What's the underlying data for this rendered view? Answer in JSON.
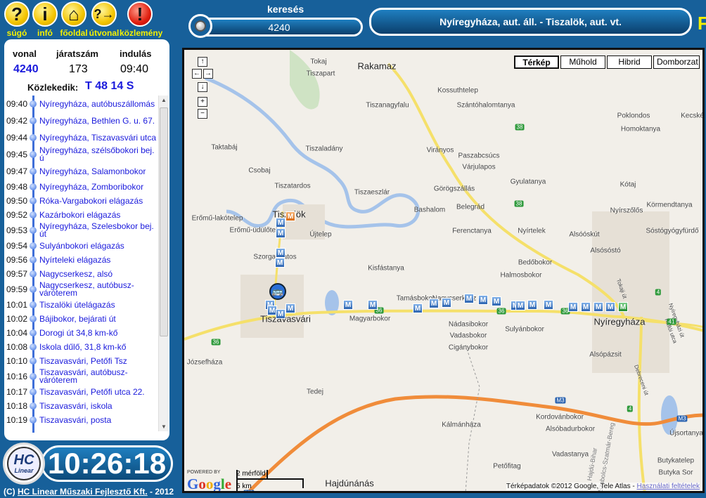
{
  "toolbar": {
    "items": [
      {
        "label": "súgó",
        "icon": "help-icon"
      },
      {
        "label": "infó",
        "icon": "info-icon"
      },
      {
        "label": "főoldal",
        "icon": "home-icon"
      },
      {
        "label": "útvonal",
        "icon": "route-icon"
      },
      {
        "label": "közlemény",
        "icon": "alert-icon"
      }
    ]
  },
  "trip": {
    "vonal_label": "vonal",
    "jaratszam_label": "járatszám",
    "indulas_label": "indulás",
    "vonal": "4240",
    "jaratszam": "173",
    "indulas": "09:40",
    "kozlekedik_label": "Közlekedik:",
    "kozlekedik": "T 48 14 S"
  },
  "stops": [
    {
      "time": "09:40",
      "name": "Nyíregyháza, autóbuszállomás"
    },
    {
      "time": "09:42",
      "name": "Nyíregyháza, Bethlen G. u. 67."
    },
    {
      "time": "09:44",
      "name": "Nyíregyháza, Tiszavasvári utca"
    },
    {
      "time": "09:45",
      "name": "Nyíregyháza, szélsőbokori bej. ú"
    },
    {
      "time": "09:47",
      "name": "Nyíregyháza, Salamonbokor"
    },
    {
      "time": "09:48",
      "name": "Nyíregyháza, Zomboribokor"
    },
    {
      "time": "09:50",
      "name": "Róka-Vargabokori elágazás"
    },
    {
      "time": "09:52",
      "name": "Kazárbokori elágazás"
    },
    {
      "time": "09:53",
      "name": "Nyíregyháza, Szelesbokor bej. út"
    },
    {
      "time": "09:54",
      "name": "Sulyánbokori elágazás"
    },
    {
      "time": "09:56",
      "name": "Nyírteleki elágazás"
    },
    {
      "time": "09:57",
      "name": "Nagycserkesz, alsó"
    },
    {
      "time": "09:59",
      "name": "Nagycserkesz, autóbusz-váróterem"
    },
    {
      "time": "10:01",
      "name": "Tiszalöki útelágazás"
    },
    {
      "time": "10:02",
      "name": "Bájibokor, bejárati út"
    },
    {
      "time": "10:04",
      "name": "Dorogi út 34,8 km-kő"
    },
    {
      "time": "10:08",
      "name": "Iskola dűlő, 31,8 km-kő"
    },
    {
      "time": "10:10",
      "name": "Tiszavasvári, Petőfi Tsz"
    },
    {
      "time": "10:16",
      "name": "Tiszavasvári, autóbusz-váróterem"
    },
    {
      "time": "10:17",
      "name": "Tiszavasvári, Petőfi utca 22."
    },
    {
      "time": "10:18",
      "name": "Tiszavasvári, iskola"
    },
    {
      "time": "10:19",
      "name": "Tiszavasvári, posta"
    }
  ],
  "clock": {
    "time": "10:26:18",
    "logo_text": "HC Linear"
  },
  "footer": {
    "prefix": "(C) ",
    "company": "HC Linear Műszaki Fejlesztő Kft.",
    "suffix": " - 2012"
  },
  "search": {
    "label": "keresés",
    "value": "4240"
  },
  "route_title": "Nyíregyháza, aut. áll. - Tiszalök, aut. vt.",
  "cut_text": "F",
  "map": {
    "types": [
      "Térkép",
      "Műhold",
      "Hibrid",
      "Domborzat"
    ],
    "active_type": "Térkép",
    "nav": {
      "up": "↑",
      "left": "←",
      "right": "→",
      "down": "↓",
      "zoom_in": "+",
      "zoom_out": "−"
    },
    "places": [
      "Tokaj",
      "Rakamaz",
      "Tiszapart",
      "Tiszanagyfalu",
      "Kossuthtelep",
      "Szántóhalomtanya",
      "Poklondos",
      "Homoktanya",
      "Kecskés",
      "Taktabáj",
      "Tiszaladány",
      "Virányos",
      "Paszabcsúcs",
      "Várjulapos",
      "Csobaj",
      "Gyulatanya",
      "Kótaj",
      "Tiszatardos",
      "Tiszaeszlár",
      "Görögszállás",
      "Bashalom",
      "Belegrád",
      "Nyírszőlős",
      "Körmendtanya",
      "Erőmű-lakótelep",
      "Erőmű-üdülőtelep",
      "Tiszalök",
      "Újtelep",
      "Ferenctanya",
      "Nyírtelek",
      "Alsóóskút",
      "Sóstógyógyfürdő",
      "Szorgalmatos",
      "Alsósóstó",
      "Kisfástanya",
      "Bedőbokor",
      "Halmosbokor",
      "Tamásbokor",
      "Nagycserkesz",
      "Magyarbokor",
      "Nádasibokor",
      "Sulyánbokor",
      "Vadasbokor",
      "Tiszavasvári",
      "Nyíregyháza",
      "Cigánybokor",
      "Józsefháza",
      "Alsópázsit",
      "Tedej",
      "Kálmánháza",
      "Kordovánbokor",
      "Alsóbadurbokor",
      "Újsortanya",
      "Vadastanya",
      "Petőfitag",
      "Butykatelep",
      "Butyka Sor",
      "Hajdúnánás",
      "Tokaji út",
      "Debreceni út",
      "Kállói utca",
      "Nyíregyházi út",
      "Hajdú-Bihar",
      "Szabolcs-Szatmár-Bereg"
    ],
    "road_numbers": [
      "38",
      "38",
      "36",
      "36",
      "36",
      "36",
      "41",
      "4",
      "4",
      "M3",
      "M3",
      "M3"
    ],
    "stop_marker": "M",
    "powered_by": "POWERED BY",
    "google": "Google",
    "scale_miles": "2 mérföld",
    "scale_km": "5 km",
    "copyright": "Térképadatok ©2012 Google, Tele Atlas - ",
    "terms": "Használati feltételek",
    "colors": {
      "motorway": "#f08c3a",
      "main_road": "#f5e06a",
      "water": "#a5c3ea",
      "stop": "#2b63b0"
    }
  }
}
